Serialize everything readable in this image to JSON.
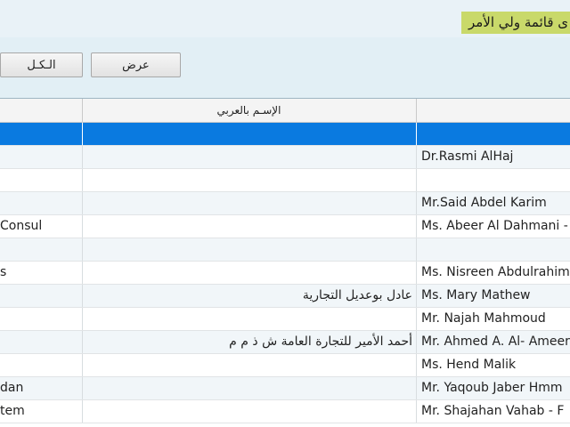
{
  "window": {
    "title": "ى قائمة ولي الأمر"
  },
  "toolbar": {
    "all_label": "الـكـل",
    "show_label": "عرض"
  },
  "grid": {
    "columns": [
      "",
      "الإسـم بالعربي",
      ""
    ],
    "rows": [
      [
        "",
        "",
        ""
      ],
      [
        "",
        "",
        "Dr.Rasmi AlHaj"
      ],
      [
        "",
        "",
        ""
      ],
      [
        "",
        "",
        "Mr.Said Abdel Karim"
      ],
      [
        "Consul",
        "",
        "Ms. Abeer Al Dahmani -"
      ],
      [
        "",
        "",
        ""
      ],
      [
        "s",
        "",
        "Ms. Nisreen Abdulrahim"
      ],
      [
        "",
        "عادل بوعديل التجارية",
        "Ms. Mary Mathew"
      ],
      [
        "",
        "",
        "Mr. Najah Mahmoud"
      ],
      [
        "",
        "أحمد الأمير للتجارة العامة ش ذ م م",
        "Mr. Ahmed A. Al- Ameer"
      ],
      [
        "",
        "",
        "Ms. Hend Malik"
      ],
      [
        "dan",
        "",
        "Mr. Yaqoub Jaber Hmm"
      ],
      [
        "tem",
        "",
        "Mr. Shajahan Vahab - F"
      ]
    ],
    "selected_row": 0
  },
  "colors": {
    "title_highlight": "#c9d96a",
    "selection": "#0a7ae0",
    "background": "#e8f1f6"
  }
}
